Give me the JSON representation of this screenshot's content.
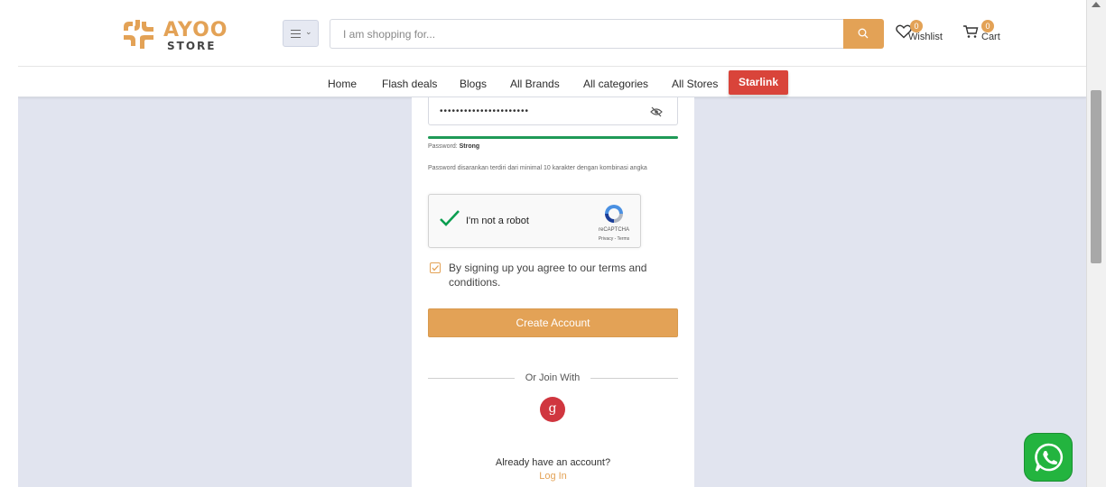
{
  "header": {
    "logo": {
      "wordmark": "AYOO",
      "subtitle": "STORE"
    },
    "search": {
      "placeholder": "I am shopping for..."
    },
    "wishlist": {
      "label": "Wishlist",
      "count": "0"
    },
    "cart": {
      "label": "Cart",
      "count": "0"
    }
  },
  "nav": {
    "links": [
      "Home",
      "Flash deals",
      "Blogs",
      "All Brands",
      "All categories",
      "All Stores"
    ],
    "highlight": "Starlink"
  },
  "form": {
    "password_value": "••••••••••••••••••••••",
    "strength_label": "Password:",
    "strength_value": "Strong",
    "strength_level": 1.0,
    "hint": "Password disarankan terdiri dari minimal 10 karakter dengan kombinasi angka",
    "captcha": {
      "label": "I'm not a robot",
      "brand": "reCAPTCHA",
      "links": "Privacy - Terms",
      "checked": true
    },
    "terms_text": "By signing up you agree to our terms and conditions.",
    "terms_checked": true,
    "submit_label": "Create Account",
    "or_join": "Or Join With",
    "google_glyph": "g",
    "have_account": "Already have an account?",
    "login_label": "Log In"
  },
  "colors": {
    "brand": "#e3a256",
    "highlight": "#d9443a",
    "strength": "#1f9a57",
    "background": "#e1e4ef",
    "whatsapp": "#23b43f",
    "google": "#d0363f"
  },
  "icons": {
    "search": "search-icon",
    "wishlist": "heart-icon",
    "cart": "cart-icon",
    "menu": "hamburger-icon",
    "eye": "eye-slash-icon",
    "whatsapp": "whatsapp-icon"
  }
}
